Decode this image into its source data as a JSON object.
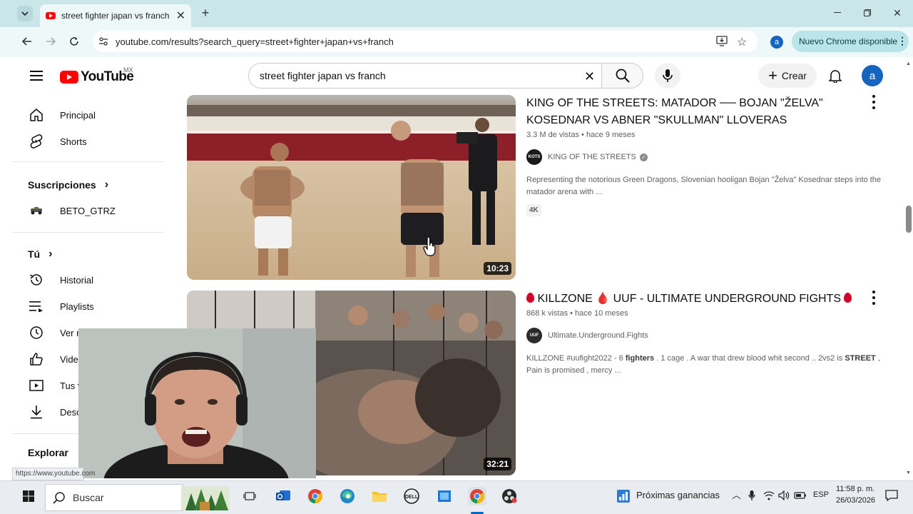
{
  "browser": {
    "tab_title": "street fighter japan vs franch - YouTube",
    "url": "youtube.com/results?search_query=street+fighter+japan+vs+franch",
    "profile_initial": "a",
    "update_label": "Nuevo Chrome disponible"
  },
  "youtube": {
    "logo_text": "YouTube",
    "region": "MX",
    "search_query": "street fighter japan vs franch",
    "create_label": "Crear",
    "avatar_initial": "a"
  },
  "sidebar": {
    "home": "Principal",
    "shorts": "Shorts",
    "subscriptions_heading": "Suscripciones",
    "subscription_channel": "BETO_GTRZ",
    "you_heading": "Tú",
    "history": "Historial",
    "playlists": "Playlists",
    "watch_later": "Ver más tarde",
    "liked": "Videos que me gustan",
    "your_videos": "Tus videos",
    "downloads": "Descargas",
    "explore_heading": "Explorar"
  },
  "results": [
    {
      "title": "KING OF THE STREETS: MATADOR ── BOJAN \"ŽELVA\" KOSEDNAR VS ABNER \"SKULLMAN\" LLOVERAS",
      "meta": "3.3 M de vistas • hace 9 meses",
      "channel": "KING OF THE STREETS",
      "description": "Representing the notorious Green Dragons, Slovenian hooligan Bojan \"Želva\" Kosednar steps into the matador arena with ...",
      "badge": "4K",
      "duration": "10:23"
    },
    {
      "title": "KILLZONE 🩸 UUF - ULTIMATE UNDERGROUND FIGHTS",
      "meta": "868 k vistas • hace 10 meses",
      "channel": "Ultimate.Underground.Fights",
      "description_pre": "KILLZONE #uufight2022 - 6 ",
      "description_bold1": "fighters",
      "description_mid": " . 1 cage . A war that drew blood whit second .. 2vs2 is ",
      "description_bold2": "STREET",
      "description_post": " , Pain is promised , mercy ...",
      "duration": "32:21"
    }
  ],
  "status_url": "https://www.youtube.com",
  "taskbar": {
    "search_placeholder": "Buscar",
    "widget_text": "Próximas ganancias",
    "language": "ESP",
    "time": "11:58 p. m.",
    "date": "26/03/2026"
  },
  "colors": {
    "chrome_frame": "#cbe6e9",
    "chrome_toolbar": "#eef8f8",
    "youtube_red": "#ff0000",
    "taskbar": "#e9ecf0"
  }
}
